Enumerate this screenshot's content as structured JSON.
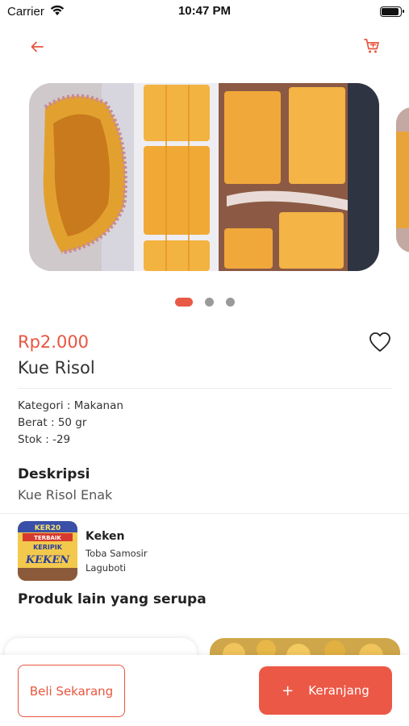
{
  "status_bar": {
    "carrier": "Carrier",
    "time": "10:47 PM"
  },
  "accent_color": "#e8553f",
  "icons": {
    "back": "arrow-left-icon",
    "cart": "shopping-cart-icon",
    "favorite": "heart-outline-icon",
    "wifi": "wifi-icon",
    "battery": "battery-icon"
  },
  "carousel": {
    "slide_count": 3,
    "active_index": 0
  },
  "product": {
    "price": "Rp2.000",
    "name": "Kue Risol",
    "category": "Kategori : Makanan",
    "weight": "Berat : 50 gr",
    "stock": "Stok : -29",
    "description_title": "Deskripsi",
    "description": "Kue Risol Enak"
  },
  "seller": {
    "name": "Keken",
    "address_line1": "Toba Samosir",
    "address_line2": "Laguboti",
    "logo_lines": [
      "KER20",
      "TERBAIK",
      "KERIPIK",
      "KEKEN"
    ]
  },
  "similar": {
    "title": "Produk lain yang serupa"
  },
  "actions": {
    "buy_now": "Beli Sekarang",
    "add_to_cart_plus": "+",
    "add_to_cart": "Keranjang"
  }
}
